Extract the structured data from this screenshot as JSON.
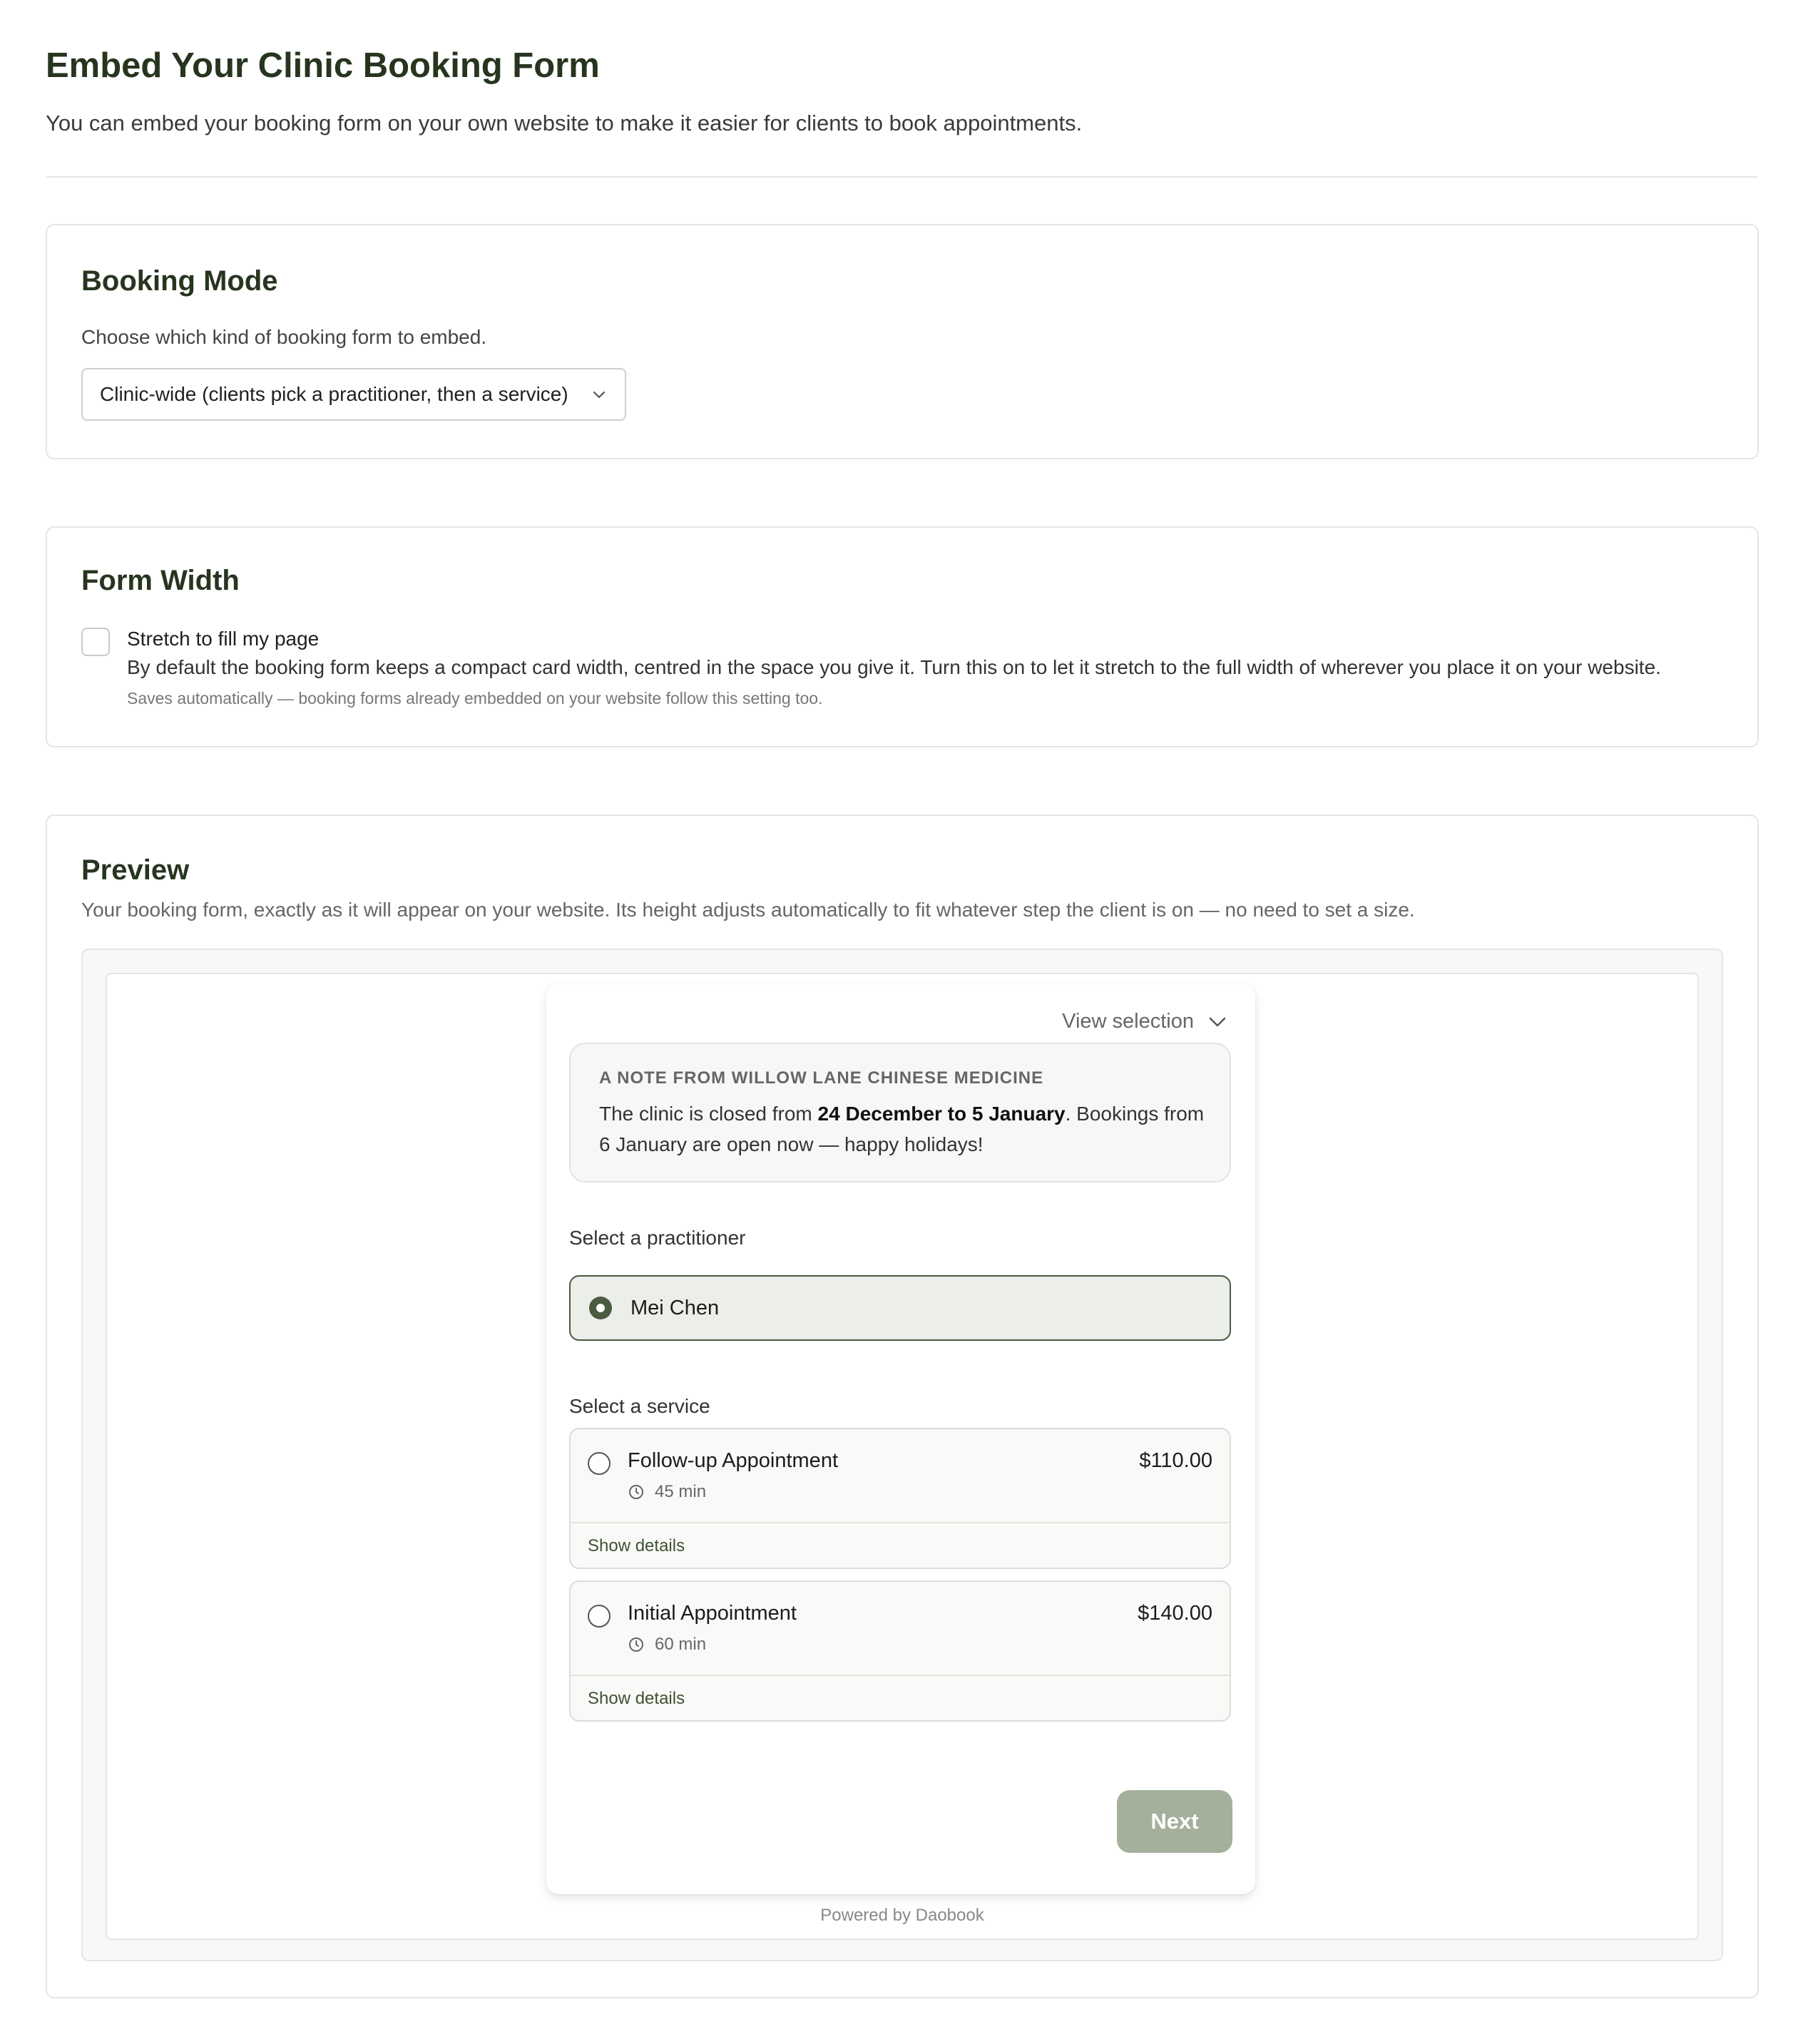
{
  "header": {
    "title": "Embed Your Clinic Booking Form",
    "subtitle": "You can embed your booking form on your own website to make it easier for clients to book appointments."
  },
  "booking_mode": {
    "title": "Booking Mode",
    "description": "Choose which kind of booking form to embed.",
    "selected": "Clinic-wide (clients pick a practitioner, then a service)",
    "icon": "chevron-down-icon"
  },
  "form_width": {
    "title": "Form Width",
    "checkbox_label": "Stretch to fill my page",
    "checked": false,
    "description": "By default the booking form keeps a compact card width, centred in the space you give it. Turn this on to let it stretch to the full width of wherever you place it on your website.",
    "note": "Saves automatically — booking forms already embedded on your website follow this setting too."
  },
  "preview": {
    "title": "Preview",
    "description": "Your booking form, exactly as it will appear on your website. Its height adjusts automatically to fit whatever step the client is on — no need to set a size.",
    "widget": {
      "view_selection": "View selection",
      "note": {
        "heading": "A NOTE FROM WILLOW LANE CHINESE MEDICINE",
        "text_before": "The clinic is closed from ",
        "text_bold": "24 December to 5 January",
        "text_after": ". Bookings from 6 January are open now — happy holidays!"
      },
      "practitioner_label": "Select a practitioner",
      "practitioners": [
        {
          "name": "Mei Chen",
          "selected": true
        }
      ],
      "service_label": "Select a service",
      "services": [
        {
          "name": "Follow-up Appointment",
          "price": "$110.00",
          "duration": "45 min",
          "details": "Show details"
        },
        {
          "name": "Initial Appointment",
          "price": "$140.00",
          "duration": "60 min",
          "details": "Show details"
        }
      ],
      "next": "Next",
      "powered_by": "Powered by Daobook"
    }
  },
  "colors": {
    "heading": "#27351f",
    "accent": "#4b5b3f",
    "next_button": "#a4b09b"
  }
}
